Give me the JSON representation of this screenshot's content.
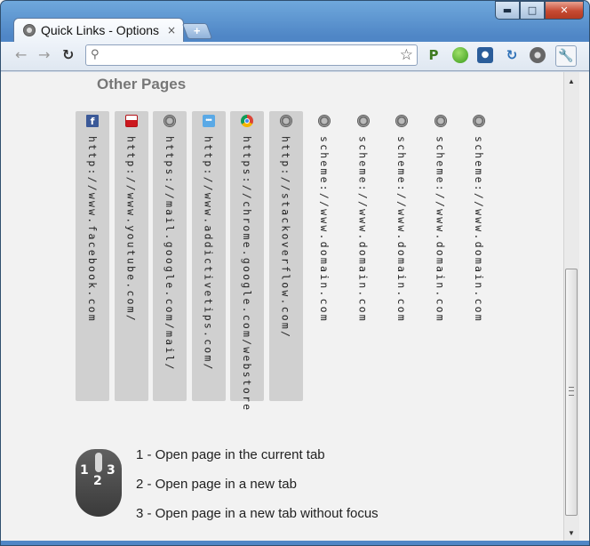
{
  "window": {
    "tab_title": "Quick Links - Options",
    "tab_close": "×",
    "new_tab": "+",
    "minimize": "▬",
    "maximize": "□",
    "close": "✕"
  },
  "toolbar": {
    "back": "←",
    "forward": "→",
    "reload": "↻",
    "search_glyph": "⚲",
    "star": "☆",
    "url_value": "",
    "extensions": [
      "p-extension-icon",
      "green-ball-icon",
      "camera-icon",
      "swirl-icon",
      "chrome-icon",
      "wrench-icon"
    ],
    "ext_p_label": "P",
    "ext_wrench_label": "🔧"
  },
  "content": {
    "section_title": "Other Pages",
    "pages": [
      {
        "icon": "facebook-icon",
        "url": "http://www.facebook.com",
        "filled": true
      },
      {
        "icon": "youtube-icon",
        "url": "http://www.youtube.com/",
        "filled": true
      },
      {
        "icon": "globe-icon",
        "url": "https://mail.google.com/mail/",
        "filled": true
      },
      {
        "icon": "addictivetips-icon",
        "url": "http://www.addictivetips.com/",
        "filled": true
      },
      {
        "icon": "chrome-webstore-icon",
        "url": "https://chrome.google.com/webstore",
        "filled": true
      },
      {
        "icon": "globe-icon",
        "url": "http://stackoverflow.com/",
        "filled": true
      },
      {
        "icon": "globe-icon",
        "url": "scheme://www.domain.com",
        "filled": false
      },
      {
        "icon": "globe-icon",
        "url": "scheme://www.domain.com",
        "filled": false
      },
      {
        "icon": "globe-icon",
        "url": "scheme://www.domain.com",
        "filled": false
      },
      {
        "icon": "globe-icon",
        "url": "scheme://www.domain.com",
        "filled": false
      },
      {
        "icon": "globe-icon",
        "url": "scheme://www.domain.com",
        "filled": false
      }
    ],
    "mouse_buttons": [
      "1",
      "2",
      "3"
    ],
    "legend": [
      "1 - Open page in the current tab",
      "2 - Open page in a new tab",
      "3 - Open page in a new tab without focus"
    ]
  }
}
